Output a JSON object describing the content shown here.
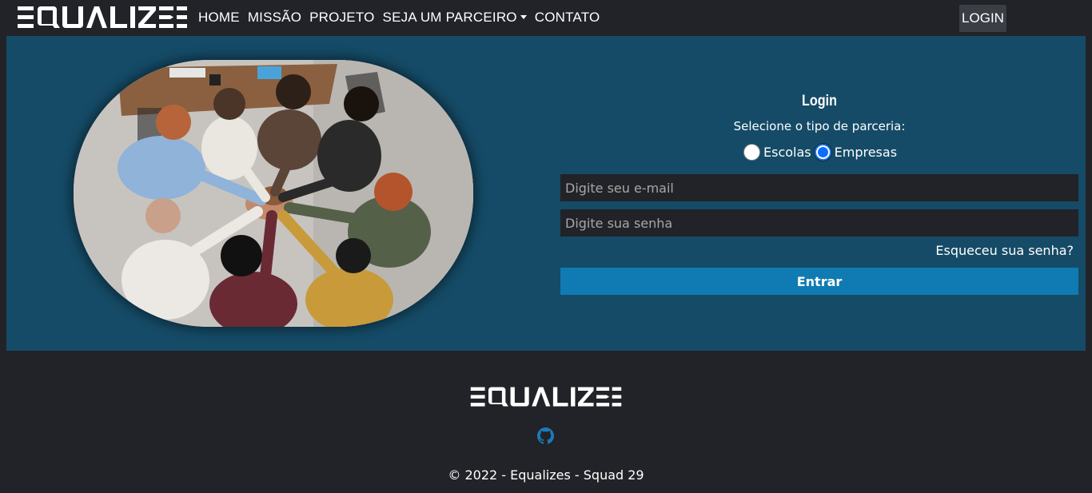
{
  "brand": {
    "name": "EQUALIZES"
  },
  "nav": {
    "items": [
      {
        "label": "HOME"
      },
      {
        "label": "MISSÃO"
      },
      {
        "label": "PROJETO"
      },
      {
        "label": "SEJA UM PARCEIRO",
        "dropdown": true
      },
      {
        "label": "CONTATO"
      }
    ],
    "login_label": "LOGIN"
  },
  "hero": {
    "image_icon": "team-hands-photo",
    "login": {
      "title": "Login",
      "subtitle": "Selecione o tipo de parceria:",
      "options": [
        {
          "label": "Escolas",
          "checked": false
        },
        {
          "label": "Empresas",
          "checked": true
        }
      ],
      "email_placeholder": "Digite seu e-mail",
      "password_placeholder": "Digite sua senha",
      "forgot_label": "Esqueceu sua senha?",
      "submit_label": "Entrar"
    }
  },
  "footer": {
    "brand": "EQUALIZES",
    "github_icon": "github-icon",
    "copyright": "© 2022 - Equalizes - Squad 29"
  },
  "colors": {
    "page_bg": "#212328",
    "hero_bg": "#154b67",
    "button_primary": "#107bb2",
    "login_nav_bg": "#3b3e45",
    "github_accent": "#1b7ab8"
  }
}
